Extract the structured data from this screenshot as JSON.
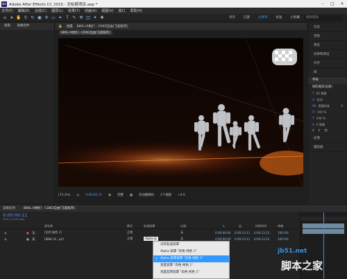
{
  "window": {
    "title": "Adobe After Effects CC 2015 - 无标题项目.aep *",
    "app_icon": "Ae"
  },
  "menu": [
    "文件(F)",
    "编辑(E)",
    "合成(C)",
    "图层(L)",
    "效果(T)",
    "动画(A)",
    "视图(V)",
    "窗口",
    "帮助(H)"
  ],
  "toolbar": {
    "workspaces": [
      "对齐",
      "已建",
      "必要项",
      "标准",
      "小屏幕",
      "库"
    ],
    "active_workspace": "必要项",
    "search_placeholder": "搜索帮助"
  },
  "left_panel": {
    "tab_project": "项目",
    "tab_effects": "效果控件"
  },
  "composition": {
    "tab_label": "合成",
    "comp_name": "880L.IX她们 - CDKD自由门[超级英]",
    "breadcrumb": "880L.IX她们 - CDKD自由门[超级英]",
    "viewer_bar": {
      "zoom": "(73.3%)",
      "time": "0:00:00:11",
      "quality": "完整",
      "camera": "活动摄像机",
      "views": "1个视图",
      "exposure": "+0.0"
    }
  },
  "right_panel": {
    "items": [
      "信息",
      "音频",
      "预览",
      "效果和预设",
      "对齐",
      "库"
    ],
    "char_header": "字符",
    "font_name": "微软雅黑(标题)",
    "font_size": "60 像素",
    "leading": "自动",
    "tracking": "度量标准",
    "tracking_val": "0",
    "scale_v": "100 %",
    "scale_h": "100 %",
    "baseline": "0 像素",
    "paragraph": "段落",
    "tracker": "跟踪器"
  },
  "timeline": {
    "tabs": [
      "渲染队列",
      "880L.IX她们 - CDKD自由门[超级英]"
    ],
    "current_time": "0:00:00:11",
    "fps_info": "00011 (25.00 fps)",
    "headers": {
      "source_name": "源名称",
      "mode": "模式",
      "trkmat": "轨道遮罩",
      "parent": "父级",
      "in": "入",
      "out": "出",
      "duration": "持续时间",
      "stretch": "伸缩"
    },
    "layers": [
      {
        "num": "1",
        "name": "[白色 纯色 1]",
        "mode": "正常",
        "trkmat": "无",
        "parent": "无",
        "in": "0:00:00:00",
        "out": "0:00:13:11",
        "duration": "0:00:13:12",
        "stretch": "100.0%"
      },
      {
        "num": "2",
        "name": "[880L.IX...p4]",
        "mode": "正常",
        "trkmat": "Alpha 反",
        "parent": "无",
        "in": "0:00:00:00",
        "out": "0:00:13:11",
        "duration": "0:00:13:12",
        "stretch": "100.0%"
      }
    ]
  },
  "track_matte_menu": {
    "items": [
      "没有轨道遮罩",
      "Alpha 遮罩 \"白色 纯色 1\"",
      "Alpha 反转遮罩 \"白色 纯色 1\"",
      "亮度遮罩 \"白色 纯色 1\"",
      "亮度反转遮罩 \"白色 纯色 1\""
    ],
    "selected_index": 2,
    "checked_index": 2
  },
  "watermark": {
    "domain": "jb51.net",
    "text": "脚本之家"
  },
  "colors": {
    "accent": "#3c8fe6",
    "menu_selected": "#3399ff",
    "panel_bg": "#232323"
  }
}
